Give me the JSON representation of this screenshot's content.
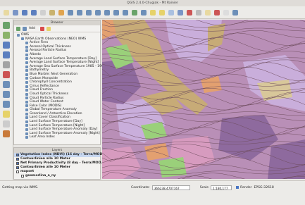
{
  "window": {
    "title": "QGIS 2.4.0-Chugiak - Mt Rainier"
  },
  "toolbar": {
    "buttons": [
      {
        "icon": "new-project-icon",
        "color": "#e8d9a0"
      },
      {
        "icon": "open-project-icon",
        "color": "#7a95c6"
      },
      {
        "icon": "save-project-icon",
        "color": "#5c7fbf"
      },
      {
        "icon": "save-as-icon",
        "color": "#5c7fbf"
      },
      {
        "icon": "print-composer-icon",
        "color": "#d0d0d0"
      },
      {
        "icon": "pan-icon",
        "color": "#c9b26e"
      },
      {
        "icon": "touch-icon",
        "color": "#e0a44f"
      },
      {
        "icon": "zoom-in-icon",
        "color": "#6d8fb8"
      },
      {
        "icon": "zoom-out-icon",
        "color": "#6d8fb8"
      },
      {
        "icon": "zoom-full-icon",
        "color": "#6d8fb8"
      },
      {
        "icon": "zoom-layer-icon",
        "color": "#6d8fb8"
      },
      {
        "icon": "zoom-selection-icon",
        "color": "#6d8fb8"
      },
      {
        "icon": "zoom-last-icon",
        "color": "#6d8fb8"
      },
      {
        "icon": "zoom-next-icon",
        "color": "#6d8fb8"
      },
      {
        "icon": "refresh-icon",
        "color": "#6aa36a"
      },
      {
        "icon": "identify-icon",
        "color": "#6d8fb8"
      },
      {
        "icon": "select-icon",
        "color": "#e6d269"
      },
      {
        "icon": "deselect-icon",
        "color": "#e6d269"
      },
      {
        "icon": "attribute-table-icon",
        "color": "#aac0e0"
      },
      {
        "icon": "field-calculator-icon",
        "color": "#7a95c6"
      },
      {
        "icon": "statistics-icon",
        "color": "#c55"
      },
      {
        "icon": "measure-icon",
        "color": "#bbb"
      },
      {
        "icon": "map-tips-icon",
        "color": "#e8d9a0"
      },
      {
        "icon": "bookmark-icon",
        "color": "#c55"
      },
      {
        "icon": "text-annotation-icon",
        "color": "#ddd"
      },
      {
        "icon": "help-icon",
        "color": "#6d8fb8"
      }
    ]
  },
  "left_tools": [
    {
      "icon": "add-vector-icon",
      "color": "#6aa36a"
    },
    {
      "icon": "add-raster-icon",
      "color": "#8bb36a"
    },
    {
      "icon": "add-postgis-icon",
      "color": "#5c7fbf"
    },
    {
      "icon": "add-spatialite-icon",
      "color": "#5c7fbf"
    },
    {
      "icon": "add-mssql-icon",
      "color": "#a3a3a3"
    },
    {
      "icon": "add-oracle-icon",
      "color": "#c55"
    },
    {
      "icon": "add-wms-icon",
      "color": "#6d8fb8"
    },
    {
      "icon": "add-wcs-icon",
      "color": "#6d8fb8"
    },
    {
      "icon": "add-wfs-icon",
      "color": "#6d8fb8"
    },
    {
      "icon": "new-shapefile-icon",
      "color": "#e6d269"
    },
    {
      "icon": "delimited-text-icon",
      "color": "#ccc"
    },
    {
      "icon": "gps-icon",
      "color": "#c97a3a"
    }
  ],
  "browser": {
    "title": "Browser",
    "add_label": "Add",
    "items": [
      {
        "label": "OWS",
        "level": 0
      },
      {
        "label": "NASA Earth Observations (NEO) WMS",
        "level": 1
      },
      {
        "label": "Active Fires",
        "level": 2
      },
      {
        "label": "Aerosol Optical Thickness",
        "level": 2
      },
      {
        "label": "Aerosol Particle Radius",
        "level": 2
      },
      {
        "label": "Albedo",
        "level": 2
      },
      {
        "label": "Average Land Surface Temperature [Day]",
        "level": 2
      },
      {
        "label": "Average Land Surface Temperature [Night]",
        "level": 2
      },
      {
        "label": "Average Sea Surface Temperature 1985 - 1997 (",
        "level": 2
      },
      {
        "label": "Bathymetry",
        "level": 2
      },
      {
        "label": "Blue Marble: Next Generation",
        "level": 2
      },
      {
        "label": "Carbon Monoxide",
        "level": 2
      },
      {
        "label": "Chlorophyll Concentration",
        "level": 2
      },
      {
        "label": "Cirrus Reflectance",
        "level": 2
      },
      {
        "label": "Cloud Fraction",
        "level": 2
      },
      {
        "label": "Cloud Optical Thickness",
        "level": 2
      },
      {
        "label": "Cloud Particle Radius",
        "level": 2
      },
      {
        "label": "Cloud Water Content",
        "level": 2
      },
      {
        "label": "False Color (MODIS)",
        "level": 2
      },
      {
        "label": "Global Temperature Anomaly",
        "level": 2
      },
      {
        "label": "Greenland / Antarctica Elevation",
        "level": 2
      },
      {
        "label": "Land Cover Classification",
        "level": 2
      },
      {
        "label": "Land Surface Temperature [Day]",
        "level": 2
      },
      {
        "label": "Land Surface Temperature [Night]",
        "level": 2
      },
      {
        "label": "Land Surface Temperature Anomaly [Day]",
        "level": 2
      },
      {
        "label": "Land Surface Temperature Anomaly [Night]",
        "level": 2
      },
      {
        "label": "Leaf Area Index",
        "level": 2
      }
    ]
  },
  "layers": {
    "title": "Layers",
    "items": [
      {
        "label": "Vegetation Index (NDVI) (16 day - Terra/MOD...",
        "checked": true,
        "bold": true,
        "selected": true,
        "indent": false
      },
      {
        "label": "Contourlinien alle 10 Meter",
        "checked": true,
        "bold": true,
        "selected": false,
        "indent": false
      },
      {
        "label": "Net Primary Productivity (8 day - Terra/MOD...",
        "checked": true,
        "bold": true,
        "selected": false,
        "indent": false
      },
      {
        "label": "Contourlinien alle 10 Meter",
        "checked": true,
        "bold": true,
        "selected": false,
        "indent": false
      },
      {
        "label": "mapset",
        "checked": false,
        "bold": true,
        "selected": false,
        "indent": false
      },
      {
        "label": "geomorlina_a_ny",
        "checked": false,
        "bold": true,
        "selected": false,
        "indent": true
      }
    ]
  },
  "status": {
    "message": "Getting map via WMS.",
    "coordinate_label": "Coordinate:",
    "coordinate_value": "366238,4707167",
    "scale_label": "Scale",
    "scale_value": "1:180,177",
    "render_label": "Render",
    "epsg_label": "EPSG:32618"
  },
  "map_colors": {
    "base": "#b98fb7",
    "purple_dark": "#8e6a9e",
    "lavender": "#c9aedb",
    "tan": "#c7ab77",
    "tan_light": "#d8c79a",
    "green": "#9ad07a",
    "orange": "#e3a070",
    "pink": "#d79bbf",
    "contour": "#6f4d5e"
  }
}
